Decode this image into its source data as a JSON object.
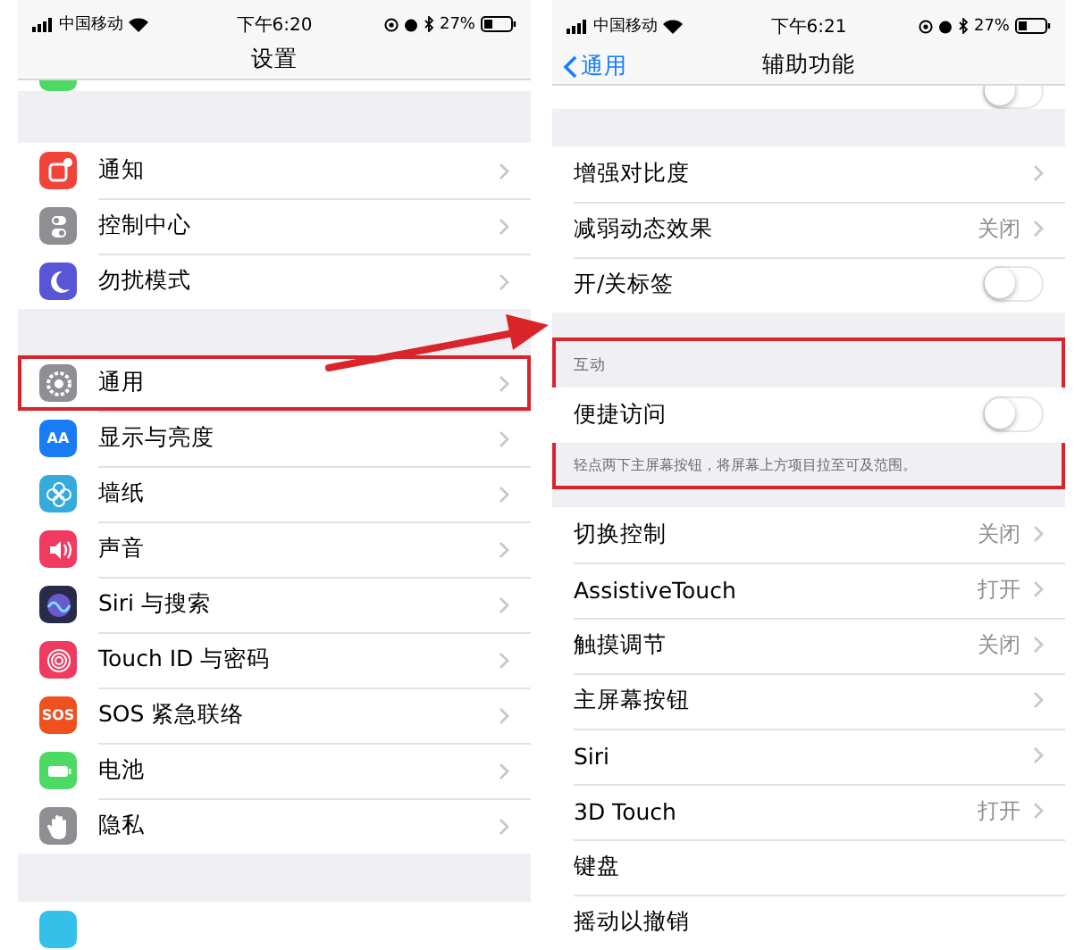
{
  "screens": [
    {
      "status_bar": {
        "carrier": "中国移动",
        "time": "下午6:20",
        "battery": "27%"
      },
      "nav": {
        "title": "设置"
      },
      "cut_icons": [
        {
          "color": "#4cd964"
        },
        {
          "color": "#34c0e8"
        }
      ],
      "groups": [
        {
          "rows": [
            {
              "label": "通知",
              "highlighted": false,
              "icon": {
                "kind": "notifications",
                "color": "#f0443a"
              }
            },
            {
              "label": "控制中心",
              "highlighted": false,
              "icon": {
                "kind": "switches",
                "color": "#8e8e93"
              }
            },
            {
              "label": "勿扰模式",
              "highlighted": false,
              "icon": {
                "kind": "moon",
                "color": "#5856d6"
              }
            }
          ]
        },
        {
          "rows": [
            {
              "label": "通用",
              "highlighted": true,
              "icon": {
                "kind": "gear",
                "color": "#8e8e93"
              }
            },
            {
              "label": "显示与亮度",
              "highlighted": false,
              "icon": {
                "kind": "text",
                "text": "AA",
                "color": "#1a7cf5"
              }
            },
            {
              "label": "墙纸",
              "highlighted": false,
              "icon": {
                "kind": "flower",
                "color": "#37aadc"
              }
            },
            {
              "label": "声音",
              "highlighted": false,
              "icon": {
                "kind": "speaker",
                "color": "#f03a5f"
              }
            },
            {
              "label": "Siri 与搜索",
              "highlighted": false,
              "icon": {
                "kind": "orb",
                "color": "#2a2a4a"
              }
            },
            {
              "label": "Touch ID 与密码",
              "highlighted": false,
              "icon": {
                "kind": "fingerprint",
                "color": "#f03a5f"
              }
            },
            {
              "label": "SOS 紧急联络",
              "highlighted": false,
              "icon": {
                "kind": "text",
                "text": "SOS",
                "color": "#f0501e"
              }
            },
            {
              "label": "电池",
              "highlighted": false,
              "icon": {
                "kind": "battery",
                "color": "#4cd964"
              }
            },
            {
              "label": "隐私",
              "highlighted": false,
              "icon": {
                "kind": "hand",
                "color": "#8e8e93"
              }
            }
          ]
        }
      ]
    },
    {
      "status_bar": {
        "carrier": "中国移动",
        "time": "下午6:21",
        "battery": "27%"
      },
      "nav": {
        "title": "辅助功能",
        "back": "通用"
      },
      "cut_toggle": {
        "on": false
      },
      "groups": [
        {
          "rows": [
            {
              "kind": "link",
              "label": "增强对比度"
            },
            {
              "kind": "link",
              "label": "减弱动态效果",
              "value": "关闭"
            },
            {
              "kind": "toggle",
              "label": "开/关标签",
              "on": false
            }
          ]
        },
        {
          "header": "互动",
          "footer": "轻点两下主屏幕按钮，将屏幕上方项目拉至可及范围。",
          "highlighted": true,
          "rows": [
            {
              "kind": "toggle",
              "label": "便捷访问",
              "on": false
            }
          ]
        },
        {
          "rows": [
            {
              "kind": "link",
              "label": "切换控制",
              "value": "关闭"
            },
            {
              "kind": "link",
              "label": "AssistiveTouch",
              "value": "打开"
            },
            {
              "kind": "link",
              "label": "触摸调节",
              "value": "关闭"
            },
            {
              "kind": "link",
              "label": "主屏幕按钮"
            },
            {
              "kind": "link",
              "label": "Siri"
            },
            {
              "kind": "link",
              "label": "3D Touch",
              "value": "打开"
            },
            {
              "kind": "plain",
              "label": "键盘"
            },
            {
              "kind": "plain",
              "label": "摇动以撤销"
            }
          ]
        }
      ]
    }
  ]
}
